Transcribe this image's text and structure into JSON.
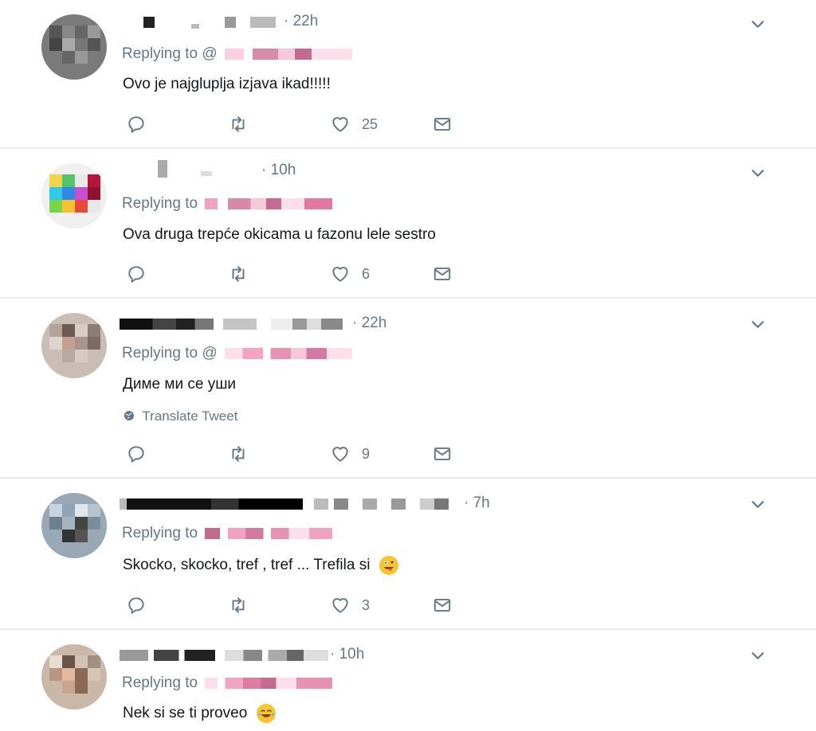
{
  "icons": {
    "reply": "reply-icon",
    "retweet": "retweet-icon",
    "like": "heart-icon",
    "message": "envelope-icon",
    "menu": "chevron-down-icon",
    "translate": "globe-icon"
  },
  "colors": {
    "muted": "#657786",
    "text": "#14171a",
    "divider": "#e6ecf0",
    "redacted_pink": "#f3a6c8",
    "redacted_dark": "#333333"
  },
  "tweets": [
    {
      "time": "· 22h",
      "replying_label": "Replying to",
      "handle_prefix": "@",
      "text": "Ovo je najgluplja izjava ikad!!!!!",
      "translate": "",
      "likes": "25"
    },
    {
      "time": "· 10h",
      "replying_label": "Replying to",
      "handle_prefix": "",
      "text": "Ova druga trepće okicama u fazonu lele sestro",
      "translate": "",
      "likes": "6"
    },
    {
      "time": "· 22h",
      "replying_label": "Replying to",
      "handle_prefix": "@",
      "text": "Диме ми се уши",
      "translate": "Translate Tweet",
      "likes": "9"
    },
    {
      "time": "· 7h",
      "replying_label": "Replying to",
      "handle_prefix": "",
      "text": "Skocko, skocko, tref , tref ... Trefila si",
      "translate": "",
      "likes": "3"
    },
    {
      "time": "· 10h",
      "replying_label": "Replying to",
      "handle_prefix": "",
      "text": "Nek si se ti proveo",
      "translate": "",
      "likes": ""
    }
  ]
}
